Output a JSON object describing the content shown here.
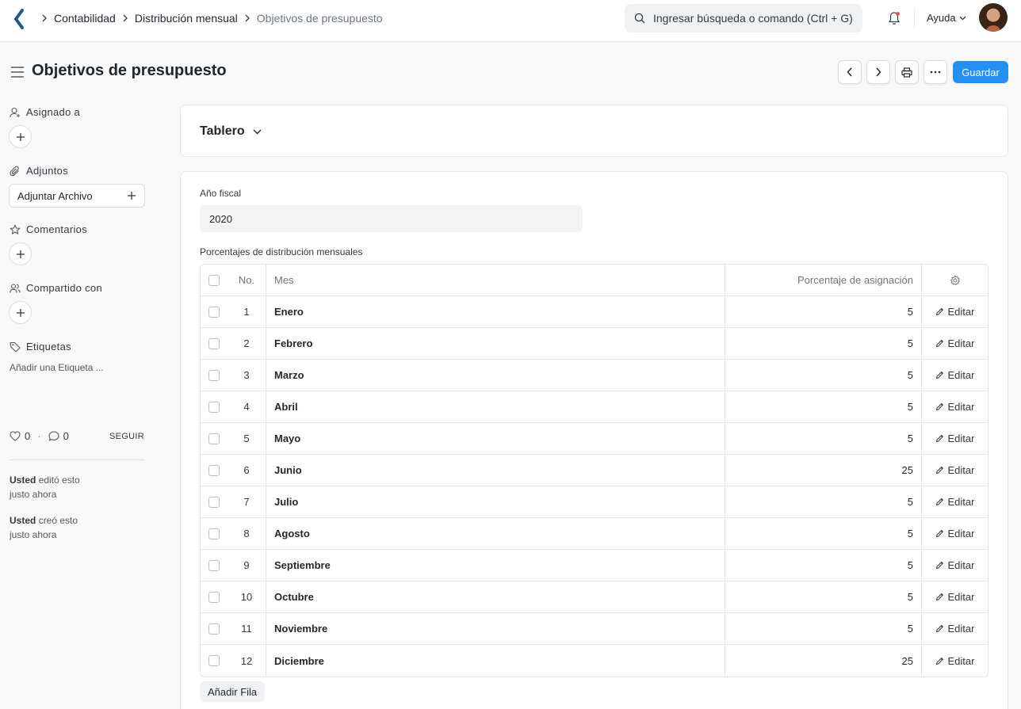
{
  "navbar": {
    "breadcrumbs": [
      "Contabilidad",
      "Distribución mensual",
      "Objetivos de presupuesto"
    ],
    "search_placeholder": "Ingresar búsqueda o comando (Ctrl + G)",
    "help_label": "Ayuda"
  },
  "page": {
    "title": "Objetivos de presupuesto",
    "save_label": "Guardar"
  },
  "sidebar": {
    "assigned_label": "Asignado a",
    "attachments_label": "Adjuntos",
    "attach_file_label": "Adjuntar Archivo",
    "comments_label": "Comentarios",
    "shared_label": "Compartido con",
    "tags_label": "Etiquetas",
    "add_tag_label": "Añadir una Etiqueta ...",
    "likes": "0",
    "comments_count": "0",
    "follow_label": "SEGUIR",
    "activity": [
      {
        "user": "Usted",
        "action": "editó esto",
        "time": "justo ahora"
      },
      {
        "user": "Usted",
        "action": "creó esto",
        "time": "justo ahora"
      }
    ]
  },
  "form": {
    "section_title": "Tablero",
    "fiscal_year_label": "Año fiscal",
    "fiscal_year_value": "2020",
    "table_label": "Porcentajes de distribución mensuales",
    "columns": {
      "no": "No.",
      "month": "Mes",
      "percentage": "Porcentaje de asignación"
    },
    "edit_label": "Editar",
    "add_row_label": "Añadir Fila",
    "rows": [
      {
        "no": "1",
        "month": "Enero",
        "pct": "5"
      },
      {
        "no": "2",
        "month": "Febrero",
        "pct": "5"
      },
      {
        "no": "3",
        "month": "Marzo",
        "pct": "5"
      },
      {
        "no": "4",
        "month": "Abril",
        "pct": "5"
      },
      {
        "no": "5",
        "month": "Mayo",
        "pct": "5"
      },
      {
        "no": "6",
        "month": "Junio",
        "pct": "25"
      },
      {
        "no": "7",
        "month": "Julio",
        "pct": "5"
      },
      {
        "no": "8",
        "month": "Agosto",
        "pct": "5"
      },
      {
        "no": "9",
        "month": "Septiembre",
        "pct": "5"
      },
      {
        "no": "10",
        "month": "Octubre",
        "pct": "5"
      },
      {
        "no": "11",
        "month": "Noviembre",
        "pct": "5"
      },
      {
        "no": "12",
        "month": "Diciembre",
        "pct": "25"
      }
    ]
  },
  "colors": {
    "primary": "#2490ef",
    "notification_dot": "#e24c4c"
  }
}
